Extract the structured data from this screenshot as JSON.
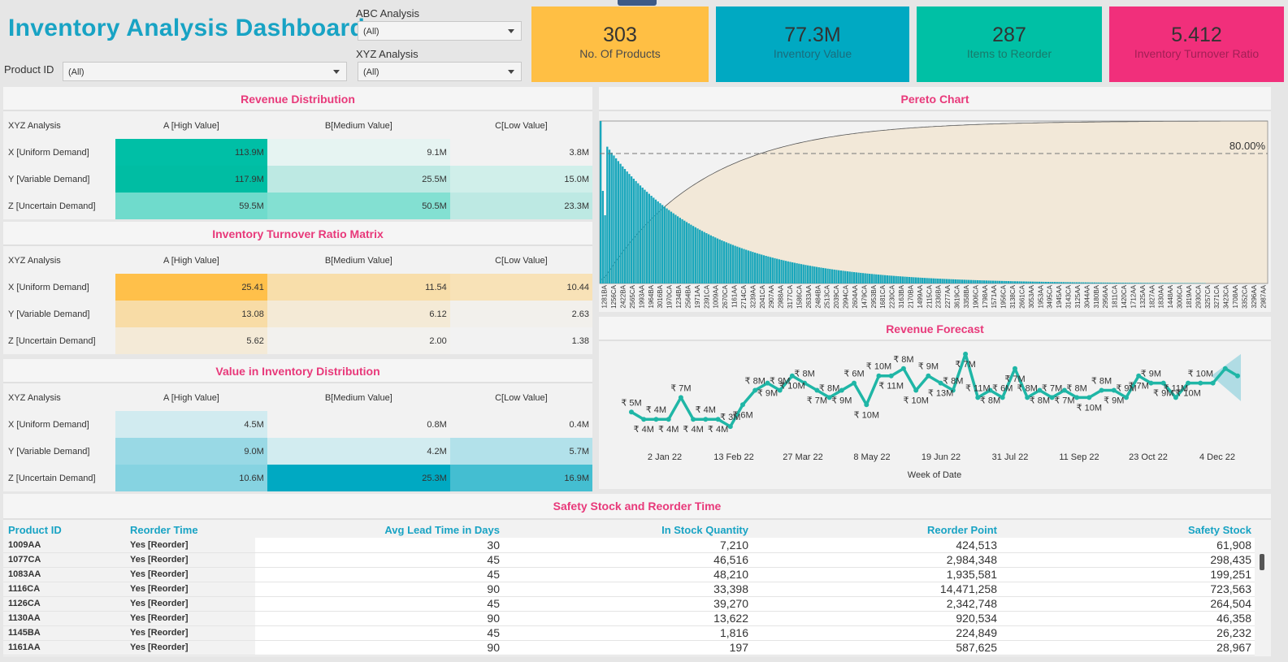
{
  "header": {
    "title": "Inventory Analysis Dashboard",
    "product_id_label": "Product ID",
    "product_id_value": "(All)",
    "abc_label": "ABC Analysis",
    "abc_value": "(All)",
    "xyz_label": "XYZ Analysis",
    "xyz_value": "(All)"
  },
  "kpis": [
    {
      "value": "303",
      "label": "No. Of Products",
      "color": "#ffbf44",
      "label_color": "#4a4a4a"
    },
    {
      "value": "77.3M",
      "label": "Inventory Value",
      "color": "#00a9c2",
      "label_color": "#1a6c7c"
    },
    {
      "value": "287",
      "label": "Items to Reorder",
      "color": "#00c0a5",
      "label_color": "#187a6b"
    },
    {
      "value": "5.412",
      "label": "Inventory Turnover Ratio",
      "color": "#f12f7b",
      "label_color": "#a21f55"
    }
  ],
  "revenue_distribution": {
    "title": "Revenue Distribution",
    "corner": "XYZ Analysis",
    "columns": [
      "A [High Value]",
      "B[Medium Value]",
      "C[Low Value]"
    ],
    "rows": [
      {
        "label": "X [Uniform Demand]",
        "cells": [
          "113.9M",
          "9.1M",
          "3.8M"
        ],
        "colors": [
          "#00bfa6",
          "#e6f4f2",
          "#f2f2f2"
        ]
      },
      {
        "label": "Y [Variable Demand]",
        "cells": [
          "117.9M",
          "25.5M",
          "15.0M"
        ],
        "colors": [
          "#00bda3",
          "#bde9e3",
          "#d0efea"
        ]
      },
      {
        "label": "Z [Uncertain Demand]",
        "cells": [
          "59.5M",
          "50.5M",
          "23.3M"
        ],
        "colors": [
          "#6fdbcc",
          "#83e0d2",
          "#bde9e3"
        ]
      }
    ]
  },
  "turnover_matrix": {
    "title": "Inventory Turnover Ratio Matrix",
    "corner": "XYZ Analysis",
    "columns": [
      "A [High Value]",
      "B[Medium Value]",
      "C[Low Value]"
    ],
    "rows": [
      {
        "label": "X [Uniform Demand]",
        "cells": [
          "25.41",
          "11.54",
          "10.44"
        ],
        "colors": [
          "#ffc04a",
          "#f8deaa",
          "#f8e2b7"
        ]
      },
      {
        "label": "Y [Variable Demand]",
        "cells": [
          "13.08",
          "6.12",
          "2.63"
        ],
        "colors": [
          "#f8dca6",
          "#f4ead6",
          "#f2f0ec"
        ]
      },
      {
        "label": "Z [Uncertain Demand]",
        "cells": [
          "5.62",
          "2.00",
          "1.38"
        ],
        "colors": [
          "#f4ead7",
          "#f2f1ee",
          "#f2f2f2"
        ]
      }
    ]
  },
  "inventory_distribution": {
    "title": "Value in Inventory Distribution",
    "corner": "XYZ Analysis",
    "columns": [
      "A [High Value]",
      "B[Medium Value]",
      "C[Low Value]"
    ],
    "rows": [
      {
        "label": "X [Uniform Demand]",
        "cells": [
          "4.5M",
          "0.8M",
          "0.4M"
        ],
        "colors": [
          "#d1ebf0",
          "#f2f2f2",
          "#f2f2f2"
        ]
      },
      {
        "label": "Y [Variable Demand]",
        "cells": [
          "9.0M",
          "4.2M",
          "5.7M"
        ],
        "colors": [
          "#99d9e5",
          "#d2ecf0",
          "#b2e1ea"
        ]
      },
      {
        "label": "Z [Uncertain Demand]",
        "cells": [
          "10.6M",
          "25.3M",
          "16.9M"
        ],
        "colors": [
          "#86d3e1",
          "#00a9c2",
          "#44bed1"
        ]
      }
    ]
  },
  "pareto": {
    "title": "Pereto Chart",
    "threshold_label": "80.00%",
    "bar_color": "#1aa7bc",
    "area_color": "#f2e8d8",
    "tick_labels": [
      "1281BA",
      "1256CA",
      "2422BA",
      "2565CA",
      "1993AA",
      "1964BA",
      "3016BA",
      "1970CA",
      "1234BA",
      "2564BA",
      "1971AA",
      "2391CA",
      "1009AA",
      "2670CA",
      "1161AA",
      "2714CA",
      "3239AA",
      "2041CA",
      "2907AA",
      "2988AA",
      "3177CA",
      "1586CA",
      "2633AA",
      "2484BA",
      "2513CA",
      "2039CA",
      "2994CA",
      "2604AA",
      "1479CA",
      "2953BA",
      "1681CA",
      "2230CA",
      "3163BA",
      "2170BA",
      "1499AA",
      "2115CA",
      "2336BA",
      "2277AA",
      "3619CA",
      "3358BA",
      "1906CA",
      "1798AA",
      "1571AA",
      "1956CA",
      "3138CA",
      "2661CA",
      "3053AA",
      "1953AA",
      "3495CA",
      "1945AA",
      "3143CA",
      "3125AA",
      "3044AA",
      "3180BA",
      "2956AA",
      "1811CA",
      "1420CA",
      "1712AA",
      "1325AA",
      "1827AA",
      "1830AA",
      "1448AA",
      "3006CA",
      "1819AA",
      "2930CA",
      "3257CA",
      "3271CA",
      "3423CA",
      "1708AA",
      "3352CA",
      "3296AA",
      "2987AA"
    ]
  },
  "forecast": {
    "title": "Revenue Forecast",
    "xlabel": "Week of Date",
    "line_color": "#1fb6a6",
    "x_ticks": [
      "2 Jan 22",
      "13 Feb 22",
      "27 Mar 22",
      "8 May 22",
      "19 Jun 22",
      "31 Jul 22",
      "11 Sep 22",
      "23 Oct 22",
      "4 Dec 22"
    ],
    "values": [
      5,
      4,
      4,
      4,
      7,
      4,
      4,
      4,
      3,
      6,
      8,
      9,
      8,
      10,
      9,
      8,
      7,
      8,
      9,
      6,
      10,
      10,
      11,
      8,
      10,
      9,
      8,
      13,
      7,
      8,
      7,
      11,
      7,
      8,
      7,
      8,
      7,
      7,
      8,
      8,
      7,
      10,
      9,
      9,
      7,
      9,
      9,
      9,
      11,
      10
    ],
    "labels": [
      "₹ 5M",
      "₹ 4M",
      "₹ 4M",
      "₹ 4M",
      "₹ 7M",
      "₹ 4M",
      "₹ 4M",
      "₹ 4M",
      "₹ 3M",
      "₹ 6M",
      "₹ 8M",
      "₹ 9M",
      "₹ 9M",
      "₹ 10M",
      "₹ 8M",
      "₹ 7M",
      "₹ 8M",
      "₹ 9M",
      "₹ 6M",
      "₹ 10M",
      "₹ 10M",
      "₹ 11M",
      "₹ 8M",
      "₹ 10M",
      "₹ 9M",
      "₹ 13M",
      "₹ 8M",
      "₹ 7M",
      "₹ 11M",
      "₹ 8M",
      "₹ 6M",
      "₹ 7M",
      "₹ 8M",
      "₹ 8M",
      "₹ 7M",
      "₹ 7M",
      "₹ 8M",
      "₹ 10M",
      "₹ 8M",
      "₹ 9M",
      "₹ 9M",
      "₹ 7M",
      "₹ 9M",
      "₹ 9M",
      "₹ 11M",
      "₹ 10M",
      "₹ 10M"
    ]
  },
  "safety_stock": {
    "title": "Safety Stock and Reorder Time",
    "columns": [
      "Product ID",
      "Reorder Time",
      "Avg Lead Time in Days",
      "In Stock Quantity",
      "Reorder Point",
      "Safety Stock"
    ],
    "rows": [
      [
        "1009AA",
        "Yes [Reorder]",
        "30",
        "7,210",
        "424,513",
        "61,908"
      ],
      [
        "1077CA",
        "Yes [Reorder]",
        "45",
        "46,516",
        "2,984,348",
        "298,435"
      ],
      [
        "1083AA",
        "Yes [Reorder]",
        "45",
        "48,210",
        "1,935,581",
        "199,251"
      ],
      [
        "1116CA",
        "Yes [Reorder]",
        "90",
        "33,398",
        "14,471,258",
        "723,563"
      ],
      [
        "1126CA",
        "Yes [Reorder]",
        "45",
        "39,270",
        "2,342,748",
        "264,504"
      ],
      [
        "1130AA",
        "Yes [Reorder]",
        "90",
        "13,622",
        "920,534",
        "46,358"
      ],
      [
        "1145BA",
        "Yes [Reorder]",
        "45",
        "1,816",
        "224,849",
        "26,232"
      ],
      [
        "1161AA",
        "Yes [Reorder]",
        "90",
        "197",
        "587,625",
        "28,967"
      ]
    ]
  }
}
